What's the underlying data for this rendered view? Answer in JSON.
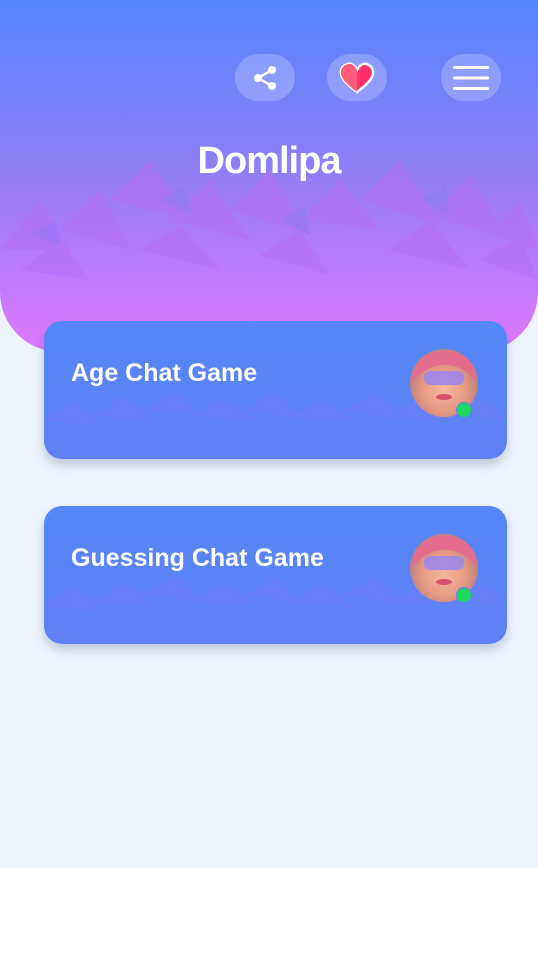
{
  "header": {
    "title": "Domlipa",
    "share_icon": "share-icon",
    "favorite_icon": "heart-icon",
    "menu_icon": "hamburger-menu-icon"
  },
  "games": [
    {
      "label": "Age Chat Game",
      "avatar": "avatar",
      "status": "online"
    },
    {
      "label": "Guessing Chat Game",
      "avatar": "avatar",
      "status": "online"
    }
  ],
  "colors": {
    "header_top": "#4f86ff",
    "header_bottom": "#df78fb",
    "card": "#5487f7",
    "background": "#eef4fd",
    "online": "#1ed760",
    "heart": "#ff3d71"
  }
}
